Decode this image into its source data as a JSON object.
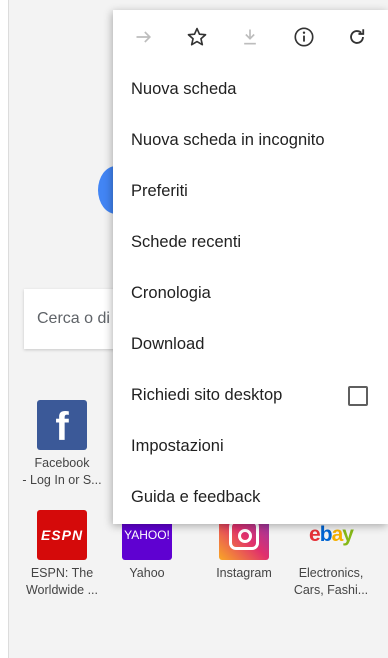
{
  "background": {
    "search_placeholder": "Cerca o di",
    "tiles_row1": [
      {
        "label_line1": "Facebook",
        "label_line2": "- Log In or S..."
      }
    ],
    "tiles_row2": [
      {
        "icon_text": "ESPN",
        "label_line1": "ESPN: The",
        "label_line2": "Worldwide ..."
      },
      {
        "icon_text": "YAHOO!",
        "label_line1": "Yahoo",
        "label_line2": ""
      },
      {
        "icon_text": "",
        "label_line1": "Instagram",
        "label_line2": ""
      },
      {
        "icon_text": "ebay",
        "label_line1": "Electronics,",
        "label_line2": "Cars, Fashi..."
      }
    ]
  },
  "menu": {
    "toolbar_icons": [
      "forward-arrow-icon",
      "star-icon",
      "download-icon",
      "info-icon",
      "refresh-icon"
    ],
    "items": [
      {
        "label": "Nuova scheda"
      },
      {
        "label": "Nuova scheda in incognito"
      },
      {
        "label": "Preferiti"
      },
      {
        "label": "Schede recenti"
      },
      {
        "label": "Cronologia"
      },
      {
        "label": "Download"
      },
      {
        "label": "Richiedi sito desktop"
      },
      {
        "label": "Impostazioni"
      },
      {
        "label": "Guida e feedback"
      }
    ],
    "desktop_site_checked": false
  },
  "colors": {
    "facebook": "#3b5998",
    "espn": "#d50a0a",
    "yahoo": "#5f01d1",
    "google_blue": "#4285f4",
    "menu_text": "#212121",
    "disabled_icon": "#bdbdbd"
  }
}
